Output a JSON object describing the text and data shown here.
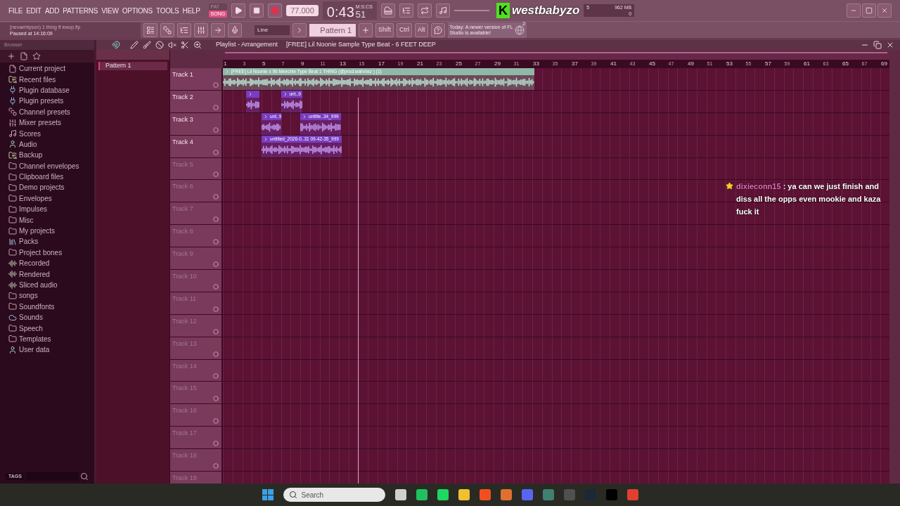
{
  "menu": [
    "FILE",
    "EDIT",
    "ADD",
    "PATTERNS",
    "VIEW",
    "OPTIONS",
    "TOOLS",
    "HELP"
  ],
  "mode": [
    {
      "label": "PAT",
      "selected": false
    },
    {
      "label": "SONG",
      "selected": true
    }
  ],
  "transport": {
    "playing": false,
    "tempo": "77.000",
    "time": "0:43",
    "time_small": "51",
    "time_unit": "M:S:CS"
  },
  "meters": {
    "cpu": "5",
    "memory": "962 MB",
    "polyphony": "0"
  },
  "logo": {
    "letter": "K",
    "name": "westbabyzo"
  },
  "hint": {
    "file": "[nevaehtyson) 1 thing ft kwop.flp",
    "status": "Paused at 14:16:09"
  },
  "snap": "Line",
  "pattern": "Pattern 1",
  "modifiers": [
    "Shift",
    "Ctrl",
    "Alt"
  ],
  "news": {
    "text": "Today: A newer version of FL Studio is available!",
    "count": "2"
  },
  "browser": {
    "title": "Browser",
    "tags": "TAGS",
    "items": [
      {
        "label": "Current project",
        "kind": "file"
      },
      {
        "label": "Recent files",
        "kind": "recent"
      },
      {
        "label": "Plugin database",
        "kind": "plugin"
      },
      {
        "label": "Plugin presets",
        "kind": "plugin"
      },
      {
        "label": "Channel presets",
        "kind": "channel"
      },
      {
        "label": "Mixer presets",
        "kind": "mixer"
      },
      {
        "label": "Scores",
        "kind": "note"
      },
      {
        "label": "Audio",
        "kind": "user"
      },
      {
        "label": "Backup",
        "kind": "recent"
      },
      {
        "label": "Channel envelopes",
        "kind": "folder"
      },
      {
        "label": "Clipboard files",
        "kind": "folder"
      },
      {
        "label": "Demo projects",
        "kind": "folder"
      },
      {
        "label": "Envelopes",
        "kind": "folder"
      },
      {
        "label": "Impulses",
        "kind": "folder"
      },
      {
        "label": "Misc",
        "kind": "folder"
      },
      {
        "label": "My projects",
        "kind": "folder"
      },
      {
        "label": "Packs",
        "kind": "packs"
      },
      {
        "label": "Project bones",
        "kind": "folder"
      },
      {
        "label": "Recorded",
        "kind": "audio"
      },
      {
        "label": "Rendered",
        "kind": "audio"
      },
      {
        "label": "Sliced audio",
        "kind": "audio"
      },
      {
        "label": "songs",
        "kind": "folder"
      },
      {
        "label": "Soundfonts",
        "kind": "folder"
      },
      {
        "label": "Sounds",
        "kind": "cloud"
      },
      {
        "label": "Speech",
        "kind": "folder"
      },
      {
        "label": "Templates",
        "kind": "folder"
      },
      {
        "label": "User data",
        "kind": "user"
      }
    ]
  },
  "patterns": [
    {
      "label": "Pattern 1",
      "selected": true
    }
  ],
  "playlist": {
    "title": "Playlist - Arrangement",
    "song": "[FREE] Lil Noonie Sample Type Beat - 6 FEET DEEP",
    "ruler": [
      "1",
      "3",
      "5",
      "7",
      "9",
      "11",
      "13",
      "15",
      "17",
      "19",
      "21",
      "23",
      "25",
      "27",
      "29",
      "31",
      "33",
      "35",
      "37",
      "39",
      "41",
      "43",
      "45",
      "47",
      "49",
      "51",
      "53",
      "55",
      "57",
      "59",
      "61",
      "63",
      "65",
      "67",
      "69"
    ],
    "tracks": [
      {
        "name": "Track 1",
        "used": true,
        "clips": [
          {
            "label": "[FREE] Lil Noonie x 9b Meechie Type Beat 1 THING (@prod.wahmez ) (1)",
            "color": "#8fb8a8"
          }
        ]
      },
      {
        "name": "Track 2",
        "used": true,
        "clips": [
          {
            "color": "#7a3cc0"
          },
          {
            "label": "unt..9",
            "color": "#7a3cc0"
          }
        ]
      },
      {
        "name": "Track 3",
        "used": true,
        "clips": [
          {
            "label": "unt..9",
            "color": "#7a3cc0"
          },
          {
            "label": "untitle..34_999",
            "color": "#7a3cc0"
          }
        ]
      },
      {
        "name": "Track 4",
        "used": true,
        "clips": [
          {
            "label": "untitled_2026-0..31 09-42-35_999",
            "color": "#7a3cc0"
          }
        ]
      },
      {
        "name": "Track 5",
        "used": false
      },
      {
        "name": "Track 6",
        "used": false
      },
      {
        "name": "Track 7",
        "used": false
      },
      {
        "name": "Track 8",
        "used": false
      },
      {
        "name": "Track 9",
        "used": false
      },
      {
        "name": "Track 10",
        "used": false
      },
      {
        "name": "Track 11",
        "used": false
      },
      {
        "name": "Track 12",
        "used": false
      },
      {
        "name": "Track 13",
        "used": false
      },
      {
        "name": "Track 14",
        "used": false
      },
      {
        "name": "Track 15",
        "used": false
      },
      {
        "name": "Track 16",
        "used": false
      },
      {
        "name": "Track 17",
        "used": false
      },
      {
        "name": "Track 18",
        "used": false
      },
      {
        "name": "Track 19",
        "used": false
      }
    ]
  },
  "chat": {
    "user": "dixieconn15",
    "message": ": ya can we just finish and diss all the opps even mookie and kaza fuck it",
    "color": "#e070b8"
  },
  "taskbar": {
    "search": "Search"
  }
}
